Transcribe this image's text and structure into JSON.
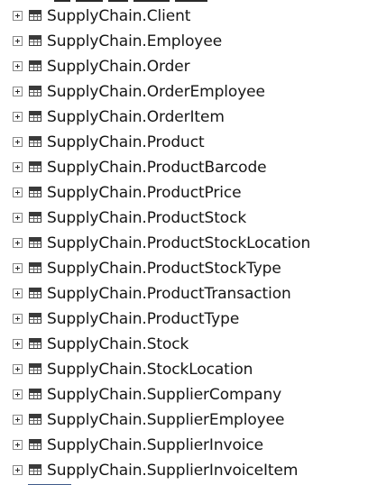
{
  "object_explorer": {
    "tables": [
      {
        "label": "SupplyChain.Client"
      },
      {
        "label": "SupplyChain.Employee"
      },
      {
        "label": "SupplyChain.Order"
      },
      {
        "label": "SupplyChain.OrderEmployee"
      },
      {
        "label": "SupplyChain.OrderItem"
      },
      {
        "label": "SupplyChain.Product"
      },
      {
        "label": "SupplyChain.ProductBarcode"
      },
      {
        "label": "SupplyChain.ProductPrice"
      },
      {
        "label": "SupplyChain.ProductStock"
      },
      {
        "label": "SupplyChain.ProductStockLocation"
      },
      {
        "label": "SupplyChain.ProductStockType"
      },
      {
        "label": "SupplyChain.ProductTransaction"
      },
      {
        "label": "SupplyChain.ProductType"
      },
      {
        "label": "SupplyChain.Stock"
      },
      {
        "label": "SupplyChain.StockLocation"
      },
      {
        "label": "SupplyChain.SupplierCompany"
      },
      {
        "label": "SupplyChain.SupplierEmployee"
      },
      {
        "label": "SupplyChain.SupplierInvoice"
      },
      {
        "label": "SupplyChain.SupplierInvoiceItem"
      }
    ],
    "icons": {
      "expand": "plus-box-icon",
      "table": "table-icon"
    }
  }
}
